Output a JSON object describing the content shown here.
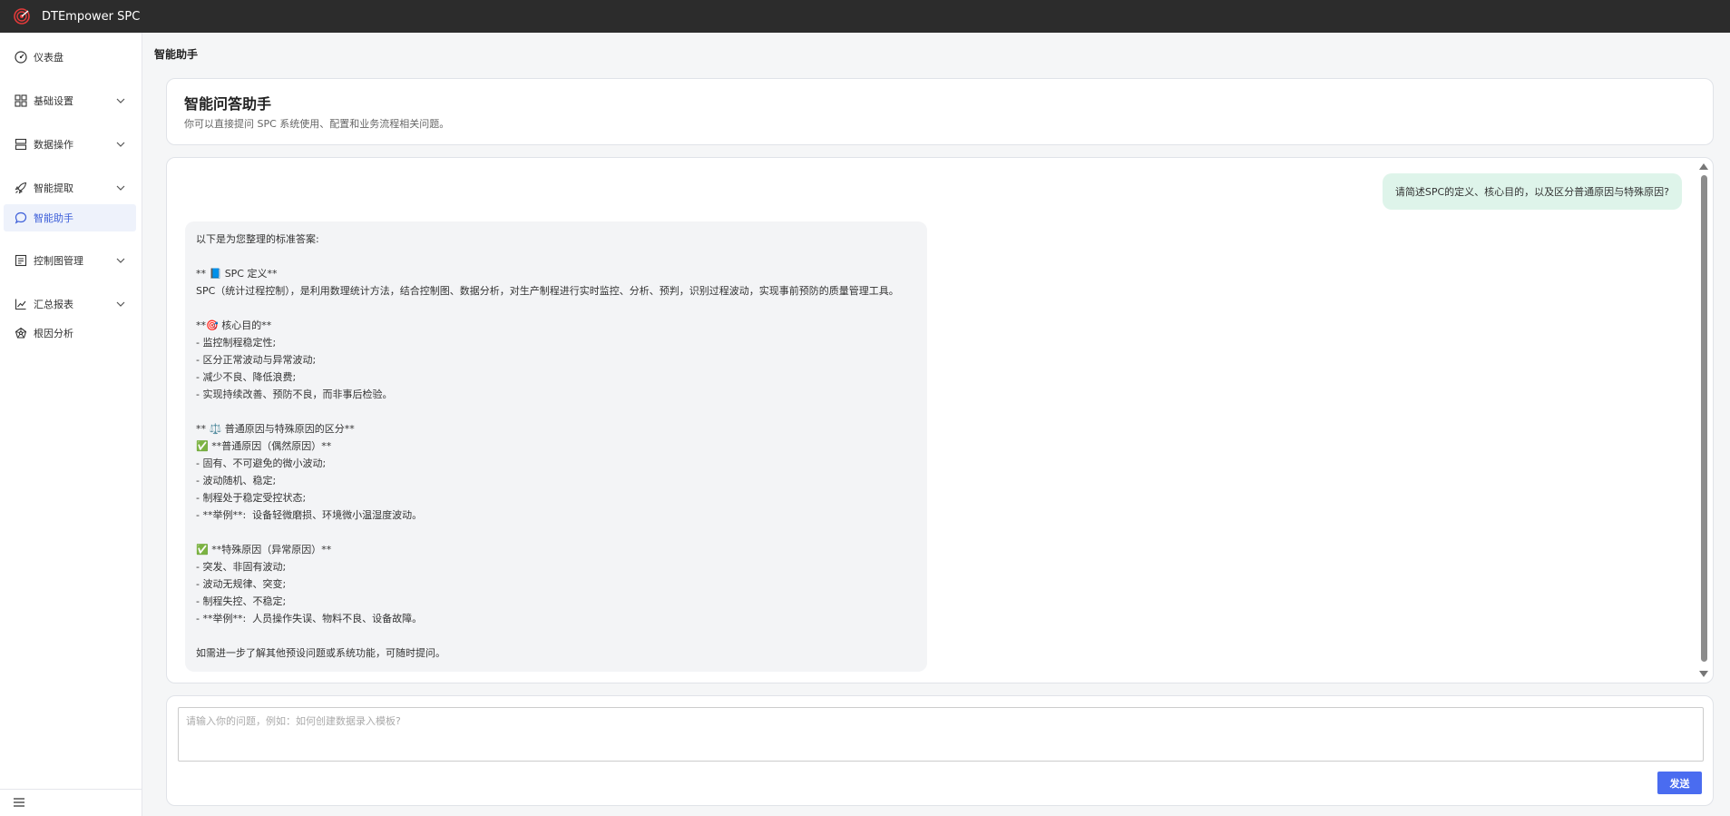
{
  "app": {
    "title": "DTEmpower SPC"
  },
  "sidebar": {
    "items": [
      {
        "label": "仪表盘",
        "icon": "gauge-icon",
        "expandable": false
      },
      {
        "label": "基础设置",
        "icon": "grid-icon",
        "expandable": true
      },
      {
        "label": "数据操作",
        "icon": "database-icon",
        "expandable": true
      },
      {
        "label": "智能提取",
        "icon": "rocket-icon",
        "expandable": true
      },
      {
        "label": "智能助手",
        "icon": "chat-bubble-icon",
        "expandable": false,
        "active": true
      },
      {
        "label": "控制图管理",
        "icon": "document-icon",
        "expandable": true
      },
      {
        "label": "汇总报表",
        "icon": "line-chart-icon",
        "expandable": true
      },
      {
        "label": "根因分析",
        "icon": "network-icon",
        "expandable": false
      }
    ],
    "footer_icon": "hamburger-menu-icon"
  },
  "page": {
    "title": "智能助手"
  },
  "header_card": {
    "title": "智能问答助手",
    "subtitle": "你可以直接提问 SPC 系统使用、配置和业务流程相关问题。"
  },
  "chat": {
    "user_message": "请简述SPC的定义、核心目的，以及区分普通原因与特殊原因?",
    "bot_lines": [
      "以下是为您整理的标准答案:",
      "",
      "** 📘 SPC 定义**",
      "SPC（统计过程控制），是利用数理统计方法，结合控制图、数据分析，对生产制程进行实时监控、分析、预判，识别过程波动，实现事前预防的质量管理工具。",
      "",
      "**🎯 核心目的**",
      "- 监控制程稳定性;",
      "- 区分正常波动与异常波动;",
      "- 减少不良、降低浪费;",
      "- 实现持续改善、预防不良，而非事后检验。",
      "",
      "** ⚖️ 普通原因与特殊原因的区分**",
      "✅ **普通原因（偶然原因）**",
      "- 固有、不可避免的微小波动;",
      "- 波动随机、稳定;",
      "- 制程处于稳定受控状态;",
      "- **举例**:  设备轻微磨损、环境微小温湿度波动。",
      "",
      "✅ **特殊原因（异常原因）**",
      "- 突发、非固有波动;",
      "- 波动无规律、突变;",
      "- 制程失控、不稳定;",
      "- **举例**:  人员操作失误、物料不良、设备故障。",
      "",
      "如需进一步了解其他预设问题或系统功能，可随时提问。"
    ]
  },
  "input": {
    "placeholder": "请输入你的问题，例如：如何创建数据录入模板?",
    "value": "",
    "send_label": "发送"
  },
  "colors": {
    "topbar": "#2c2c2c",
    "accent": "#4a6cf0",
    "user_bubble": "#def4ea",
    "bot_bubble": "#f3f4f6"
  }
}
